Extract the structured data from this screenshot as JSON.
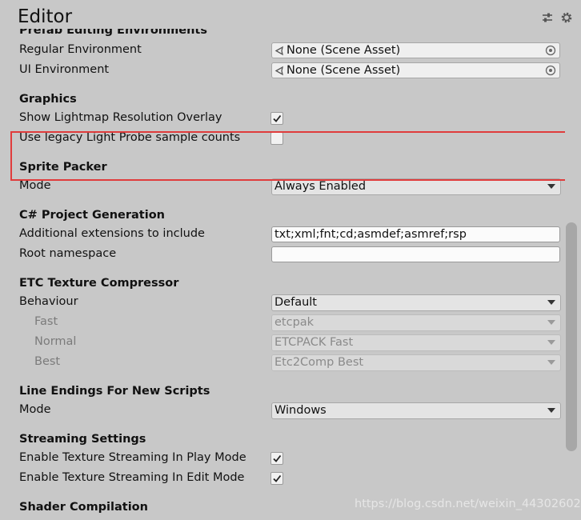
{
  "window": {
    "title": "Editor"
  },
  "prefab": {
    "header": "Prefab Editing Environments",
    "regular_label": "Regular Environment",
    "regular_value": "None (Scene Asset)",
    "ui_label": "UI Environment",
    "ui_value": "None (Scene Asset)"
  },
  "graphics": {
    "header": "Graphics",
    "lightmap_label": "Show Lightmap Resolution Overlay",
    "lightmap_checked": true,
    "lightprobe_label": "Use legacy Light Probe sample counts",
    "lightprobe_checked": false
  },
  "sprite_packer": {
    "header": "Sprite Packer",
    "mode_label": "Mode",
    "mode_value": "Always Enabled"
  },
  "csharp": {
    "header": "C# Project Generation",
    "extensions_label": "Additional extensions to include",
    "extensions_value": "txt;xml;fnt;cd;asmdef;asmref;rsp",
    "namespace_label": "Root namespace",
    "namespace_value": ""
  },
  "etc": {
    "header": "ETC Texture Compressor",
    "behaviour_label": "Behaviour",
    "behaviour_value": "Default",
    "fast_label": "Fast",
    "fast_value": "etcpak",
    "normal_label": "Normal",
    "normal_value": "ETCPACK Fast",
    "best_label": "Best",
    "best_value": "Etc2Comp Best"
  },
  "line_endings": {
    "header": "Line Endings For New Scripts",
    "mode_label": "Mode",
    "mode_value": "Windows"
  },
  "streaming": {
    "header": "Streaming Settings",
    "play_label": "Enable Texture Streaming In Play Mode",
    "play_checked": true,
    "edit_label": "Enable Texture Streaming In Edit Mode",
    "edit_checked": true
  },
  "shader": {
    "header": "Shader Compilation"
  },
  "watermark": "https://blog.csdn.net/weixin_44302602"
}
